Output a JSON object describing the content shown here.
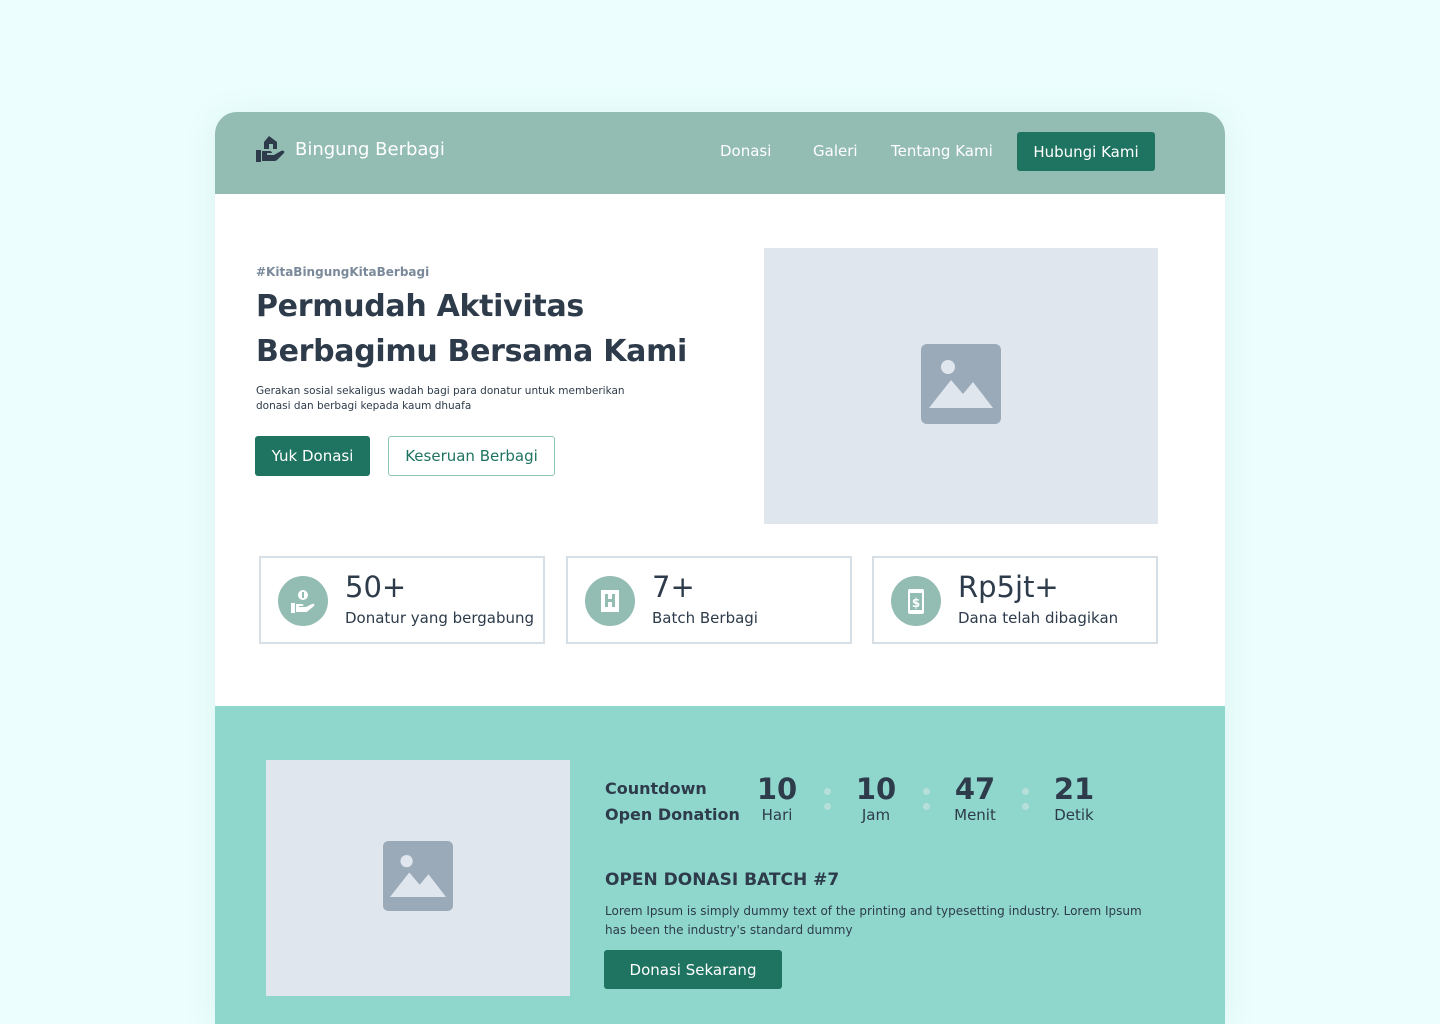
{
  "brand": {
    "name": "Bingung Berbagi",
    "icon": "hand-house-icon"
  },
  "nav": {
    "links": [
      "Donasi",
      "Galeri",
      "Tentang Kami"
    ],
    "contact_label": "Hubungi Kami"
  },
  "hero": {
    "tagline": "#KitaBingungKitaBerbagi",
    "title_line1": "Permudah Aktivitas",
    "title_line2": "Berbagimu Bersama Kami",
    "description": "Gerakan sosial sekaligus wadah bagi para donatur untuk memberikan donasi dan berbagi kepada kaum dhuafa",
    "primary_button": "Yuk Donasi",
    "secondary_button": "Keseruan Berbagi"
  },
  "stats": [
    {
      "value": "50+",
      "label": "Donatur yang bergabung",
      "icon": "donor-hand-icon"
    },
    {
      "value": "7+",
      "label": "Batch Berbagi",
      "icon": "batch-bag-icon"
    },
    {
      "value": "Rp5jt+",
      "label": "Dana telah dibagikan",
      "icon": "money-phone-icon"
    }
  ],
  "countdown": {
    "heading_line1": "Countdown",
    "heading_line2": "Open Donation",
    "units": [
      {
        "value": "10",
        "label": "Hari"
      },
      {
        "value": "10",
        "label": "Jam"
      },
      {
        "value": "47",
        "label": "Menit"
      },
      {
        "value": "21",
        "label": "Detik"
      }
    ],
    "batch_title": "OPEN DONASI BATCH #7",
    "batch_description": "Lorem Ipsum is simply dummy text of the printing and typesetting industry. Lorem Ipsum has been the industry's standard dummy",
    "cta": "Donasi Sekarang"
  },
  "colors": {
    "page_background": "#ecfefd",
    "navbar": "#93bcb2",
    "primary": "#1f7361",
    "countdown_background": "#8fd7cd",
    "placeholder": "#e0e6ee",
    "text": "#2d3b4a"
  }
}
